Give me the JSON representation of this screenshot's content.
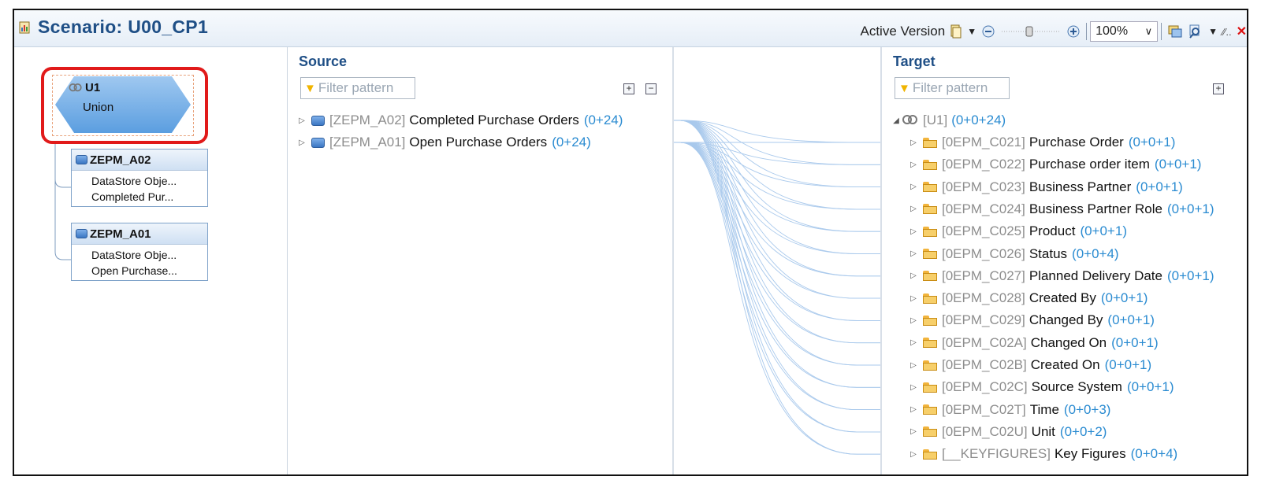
{
  "header": {
    "title": "Scenario: U00_CP1"
  },
  "toolbar": {
    "active_version_label": "Active Version",
    "zoom_value": "100%"
  },
  "graph": {
    "union_node": {
      "name": "U1",
      "type": "Union"
    },
    "nodes": [
      {
        "name": "ZEPM_A02",
        "line1": "DataStore Obje...",
        "line2": "Completed Pur..."
      },
      {
        "name": "ZEPM_A01",
        "line1": "DataStore Obje...",
        "line2": "Open Purchase..."
      }
    ]
  },
  "source": {
    "header": "Source",
    "filter_placeholder": "Filter pattern",
    "items": [
      {
        "tech": "[ZEPM_A02]",
        "name": "Completed Purchase Orders",
        "count": "(0+24)"
      },
      {
        "tech": "[ZEPM_A01]",
        "name": "Open Purchase Orders",
        "count": "(0+24)"
      }
    ]
  },
  "target": {
    "header": "Target",
    "filter_placeholder": "Filter pattern",
    "root": {
      "tech": "[U1]",
      "count": "(0+0+24)"
    },
    "items": [
      {
        "tech": "[0EPM_C021]",
        "name": "Purchase Order",
        "count": "(0+0+1)"
      },
      {
        "tech": "[0EPM_C022]",
        "name": "Purchase order item",
        "count": "(0+0+1)"
      },
      {
        "tech": "[0EPM_C023]",
        "name": "Business Partner",
        "count": "(0+0+1)"
      },
      {
        "tech": "[0EPM_C024]",
        "name": "Business Partner Role",
        "count": "(0+0+1)"
      },
      {
        "tech": "[0EPM_C025]",
        "name": "Product",
        "count": "(0+0+1)"
      },
      {
        "tech": "[0EPM_C026]",
        "name": "Status",
        "count": "(0+0+4)"
      },
      {
        "tech": "[0EPM_C027]",
        "name": "Planned Delivery Date",
        "count": "(0+0+1)"
      },
      {
        "tech": "[0EPM_C028]",
        "name": "Created By",
        "count": "(0+0+1)"
      },
      {
        "tech": "[0EPM_C029]",
        "name": "Changed By",
        "count": "(0+0+1)"
      },
      {
        "tech": "[0EPM_C02A]",
        "name": "Changed On",
        "count": "(0+0+1)"
      },
      {
        "tech": "[0EPM_C02B]",
        "name": "Created On",
        "count": "(0+0+1)"
      },
      {
        "tech": "[0EPM_C02C]",
        "name": "Source System",
        "count": "(0+0+1)"
      },
      {
        "tech": "[0EPM_C02T]",
        "name": "Time",
        "count": "(0+0+3)"
      },
      {
        "tech": "[0EPM_C02U]",
        "name": "Unit",
        "count": "(0+0+2)"
      },
      {
        "tech": "[__KEYFIGURES]",
        "name": "Key Figures",
        "count": "(0+0+4)"
      }
    ]
  }
}
